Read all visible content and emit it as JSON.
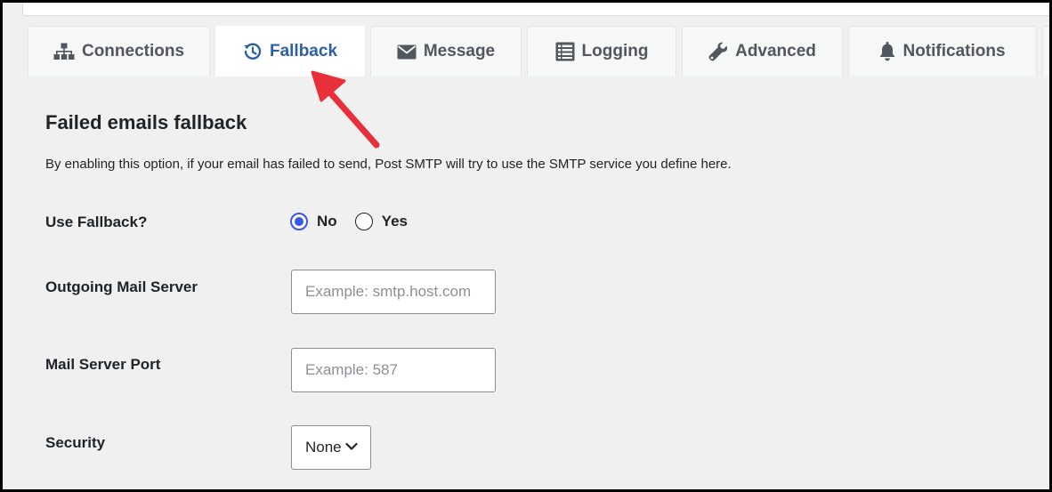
{
  "tabs": [
    {
      "label": "Connections",
      "icon": "sitemap-icon",
      "active": false
    },
    {
      "label": "Fallback",
      "icon": "history-icon",
      "active": true
    },
    {
      "label": "Message",
      "icon": "envelope-icon",
      "active": false
    },
    {
      "label": "Logging",
      "icon": "list-icon",
      "active": false
    },
    {
      "label": "Advanced",
      "icon": "wrench-icon",
      "active": false
    },
    {
      "label": "Notifications",
      "icon": "bell-icon",
      "active": false
    }
  ],
  "section": {
    "title": "Failed emails fallback",
    "description": "By enabling this option, if your email has failed to send, Post SMTP will try to use the SMTP service you define here."
  },
  "fields": {
    "use_fallback": {
      "label": "Use Fallback?",
      "options": [
        {
          "label": "No",
          "checked": true
        },
        {
          "label": "Yes",
          "checked": false
        }
      ]
    },
    "outgoing_server": {
      "label": "Outgoing Mail Server",
      "value": "",
      "placeholder": "Example: smtp.host.com"
    },
    "server_port": {
      "label": "Mail Server Port",
      "value": "",
      "placeholder": "Example: 587"
    },
    "security": {
      "label": "Security",
      "selected": "None"
    }
  },
  "colors": {
    "active_tab_text": "#2c5fa3",
    "inactive_tab_text": "#50575e",
    "radio_checked": "#3858e9",
    "annotation_arrow": "#e8303a",
    "page_background": "#f0f0f1"
  }
}
